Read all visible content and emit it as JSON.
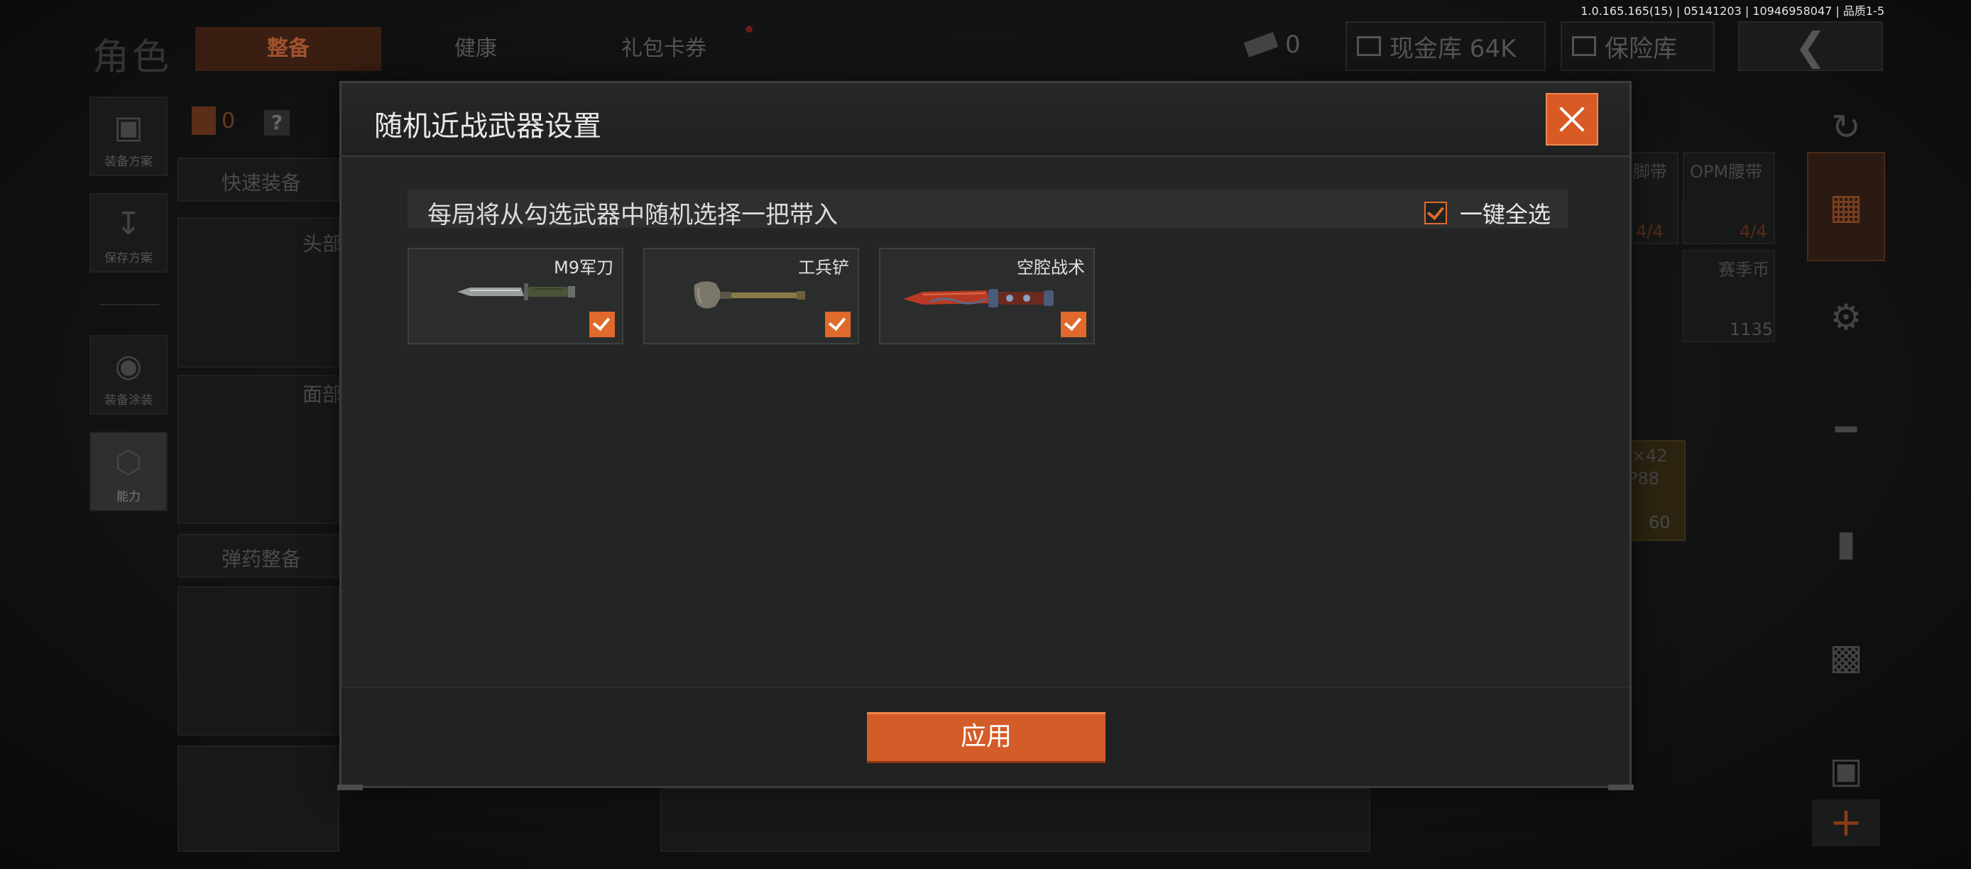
{
  "version": "1.0.165.165(15) | 05141203 | 10946958047 | 品质1-5",
  "background": {
    "title": "角色",
    "tabs": {
      "equip": "整备",
      "health": "健康",
      "pack": "礼包卡券"
    },
    "currency": {
      "ammo_count": "0",
      "cash_label": "现金库 64K",
      "safe_label": "保险库"
    },
    "left_buttons": {
      "equip_plan": "装备方案",
      "save_plan": "保存方案",
      "equip_paint": "装备涂装",
      "ability": "能力"
    },
    "backpack_count": "0",
    "quick_equip": "快速装备",
    "head": "头部",
    "face": "面部",
    "ammo_equip": "弹药整备",
    "items": {
      "armband1": "脚带",
      "armband2": "OPM腰带",
      "armband1_count": "4/4",
      "armband2_count": "4/4",
      "coin_label": "赛季币",
      "coin_count": "1135",
      "ammo_x": "×42",
      "ammo_name": "P88",
      "ammo_count": "60"
    }
  },
  "modal": {
    "title": "随机近战武器设置",
    "instruction": "每局将从勾选武器中随机选择一把带入",
    "select_all": "一键全选",
    "select_all_checked": true,
    "weapons": [
      {
        "name": "M9军刀",
        "icon": "bayonet-knife-icon",
        "checked": true
      },
      {
        "name": "工兵铲",
        "icon": "shovel-icon",
        "checked": true
      },
      {
        "name": "空腔战术",
        "icon": "tactical-knife-icon",
        "checked": true
      }
    ],
    "apply_label": "应用"
  },
  "colors": {
    "accent": "#d85a24",
    "panel": "#242525",
    "checkbox": "#e06a2c"
  }
}
